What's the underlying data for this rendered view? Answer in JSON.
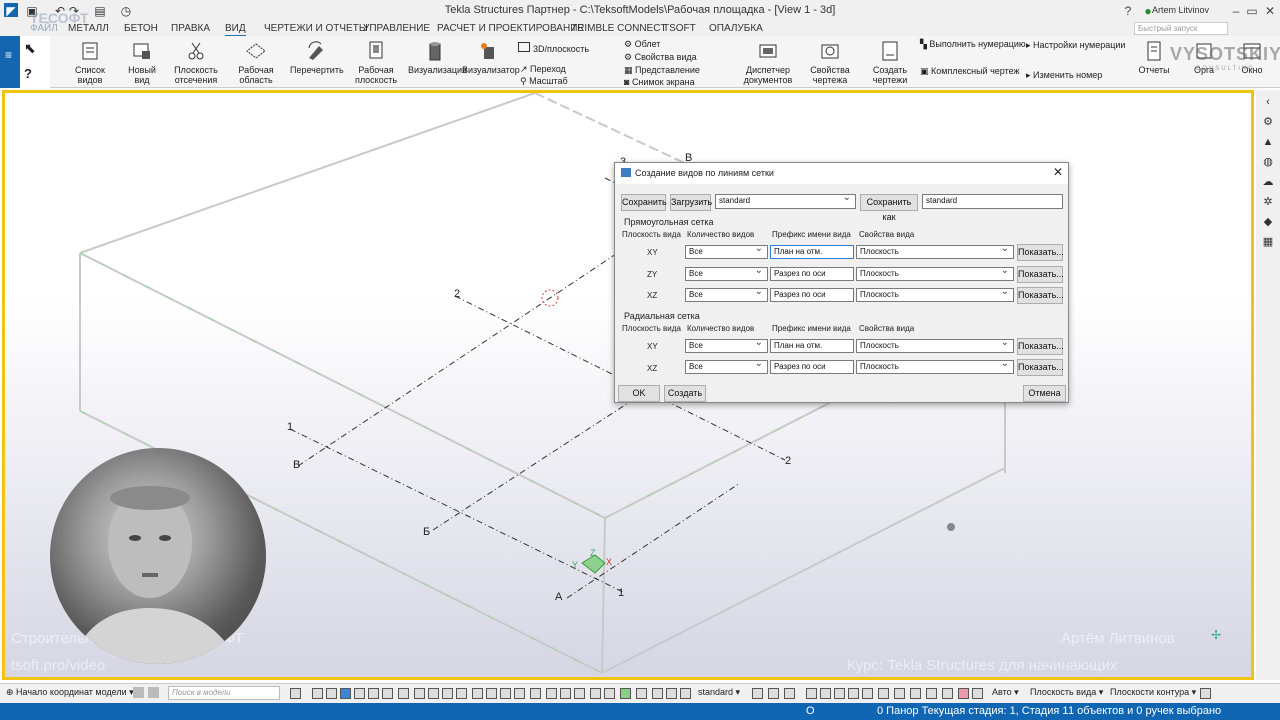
{
  "window": {
    "title": "Tekla Structures Партнер - C:\\TeksoftModels\\Рабочая площадка - [View 1 - 3d]",
    "user": "Artem Litvinov",
    "quick_search_placeholder": "Быстрый запуск"
  },
  "brand": {
    "left_logo": "ТЕСОФТ",
    "right_logo": "VYSOTSKIY",
    "right_logo_sub": "CONSULTING"
  },
  "menu": [
    "ФАЙЛ",
    "МЕТАЛЛ",
    "БЕТОН",
    "ПРАВКА",
    "ВИД",
    "ЧЕРТЕЖИ И ОТЧЕТЫ",
    "УПРАВЛЕНИЕ",
    "РАСЧЕТ И ПРОЕКТИРОВАНИЕ",
    "TRIMBLE CONNECT",
    "TSOFT",
    "ОПАЛУБКА"
  ],
  "ribbon": {
    "list_views": "Список видов",
    "new_view": "Новый вид",
    "clip_plane": "Плоскость отсечения",
    "work_area": "Рабочая область",
    "redraw": "Перечертить",
    "work_plane": "Рабочая плоскость",
    "visualization": "Визуализация",
    "visualizer": "Визуализатор",
    "view_3d_plane": "3D/плоскость",
    "transition": "Переход",
    "scale": "Масштаб",
    "fly": "Облет",
    "view_props": "Свойства вида",
    "representation": "Представление",
    "screenshot": "Снимок экрана",
    "doc_manager": "Диспетчер документов",
    "drawing_props": "Свойства чертежа",
    "create_drawings": "Создать чертежи",
    "do_numbering": "Выполнить нумерацию",
    "complex_drawing": "Комплексный чертеж",
    "numbering_settings": "Настройки нумерации",
    "change_number": "Изменить номер",
    "reports": "Отчеты",
    "organizer": "Орга",
    "window_btn": "Окно"
  },
  "dialog": {
    "title": "Создание видов по линиям сетки",
    "save": "Сохранить",
    "load": "Загрузить",
    "preset": "standard",
    "save_as": "Сохранить как",
    "save_as_value": "standard",
    "rect_section": "Прямоугольная сетка",
    "radial_section": "Радиальная сетка",
    "col_plane": "Плоскость вида",
    "col_count": "Количество видов",
    "col_prefix": "Префикс имени вида",
    "col_props": "Свойства вида",
    "show": "Показать...",
    "rect_rows": [
      {
        "plane": "XY",
        "count": "Все",
        "prefix": "План на отм.",
        "props": "Плоскость"
      },
      {
        "plane": "ZY",
        "count": "Все",
        "prefix": "Разрез по оси",
        "props": "Плоскость"
      },
      {
        "plane": "XZ",
        "count": "Все",
        "prefix": "Разрез по оси",
        "props": "Плоскость"
      }
    ],
    "radial_rows": [
      {
        "plane": "XY",
        "count": "Все",
        "prefix": "План на отм.",
        "props": "Плоскость"
      },
      {
        "plane": "XZ",
        "count": "Все",
        "prefix": "Разрез по оси",
        "props": "Плоскость"
      }
    ],
    "ok": "OK",
    "create": "Создать",
    "cancel": "Отмена"
  },
  "grid_labels": {
    "l3": "3",
    "lB_top": "В",
    "l2_top": "2",
    "l1": "1",
    "lB_left": "В",
    "lB2": "Б",
    "l2_right": "2",
    "lA": "А",
    "l1_bottom": "1"
  },
  "axes": {
    "x": "X",
    "y": "Y",
    "z": "Z"
  },
  "watermarks": {
    "left_top": "Строительные решения ТЕСОФТ",
    "left_bottom": "tsoft.pro/video",
    "right_top": "Артём Литвинов",
    "right_bottom": "Курс: Tekla Structures для начинающих"
  },
  "bottom_toolbar": {
    "origin": "Начало координат модели",
    "search_placeholder": "Поиск в модели",
    "standard": "standard",
    "auto": "Авто",
    "view_plane": "Плоскость вида",
    "contour_plane": "Плоскости контура"
  },
  "status": {
    "o": "O",
    "pan": "0 Панор Текущая стадия: 1, Стадия 1",
    "selected": "1 объектов и 0 ручек выбрано"
  }
}
